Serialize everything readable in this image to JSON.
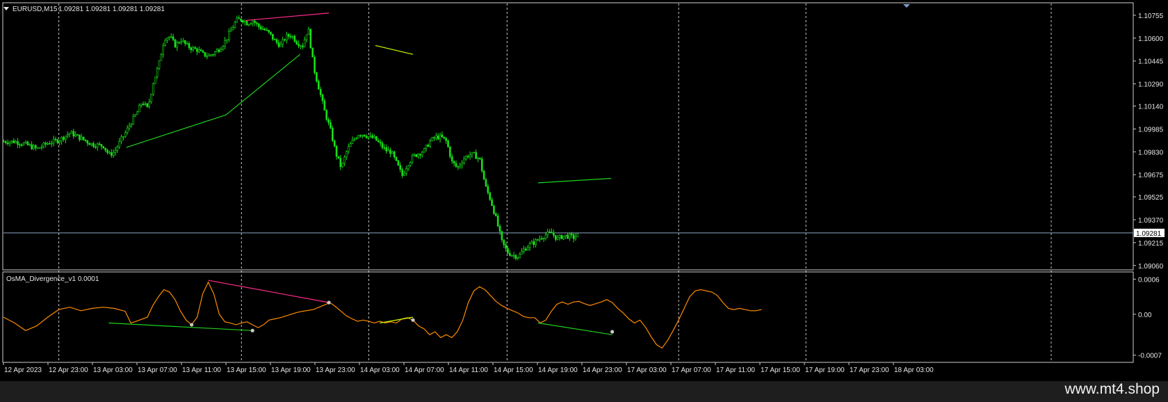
{
  "chart_data": [
    {
      "type": "candlestick",
      "symbol_label": "EURUSD,M15",
      "ohlc_readout": "1.09281 1.09281 1.09281 1.09281",
      "yticks": [
        "1.10755",
        "1.10600",
        "1.10445",
        "1.10290",
        "1.10140",
        "1.09985",
        "1.09830",
        "1.09675",
        "1.09525",
        "1.09370",
        "1.09215",
        "1.09060"
      ],
      "ylim": [
        1.0904,
        1.1083
      ],
      "current_price": 1.09281,
      "current_price_label": "1.09281",
      "xticks": [
        "12 Apr 2023",
        "12 Apr 23:00",
        "13 Apr 03:00",
        "13 Apr 07:00",
        "13 Apr 11:00",
        "13 Apr 15:00",
        "13 Apr 19:00",
        "13 Apr 23:00",
        "14 Apr 03:00",
        "14 Apr 07:00",
        "14 Apr 11:00",
        "14 Apr 15:00",
        "14 Apr 19:00",
        "14 Apr 23:00",
        "17 Apr 03:00",
        "17 Apr 07:00",
        "17 Apr 11:00",
        "17 Apr 15:00",
        "17 Apr 19:00",
        "17 Apr 23:00",
        "18 Apr 03:00"
      ],
      "price_path": [
        [
          0,
          1.099
        ],
        [
          1,
          1.099
        ],
        [
          2,
          1.0988
        ],
        [
          3,
          1.0985
        ],
        [
          4,
          1.0989
        ],
        [
          5,
          1.0991
        ],
        [
          6,
          1.0996
        ],
        [
          7,
          1.0992
        ],
        [
          8,
          1.0988
        ],
        [
          9,
          1.0987
        ],
        [
          9.5,
          1.0981
        ],
        [
          10,
          1.0983
        ],
        [
          10.5,
          1.099
        ],
        [
          11,
          1.0996
        ],
        [
          11.5,
          1.1003
        ],
        [
          12,
          1.1009
        ],
        [
          12.5,
          1.1017
        ],
        [
          13,
          1.1012
        ],
        [
          13.5,
          1.103
        ],
        [
          14,
          1.1042
        ],
        [
          14.5,
          1.106
        ],
        [
          15,
          1.1061
        ],
        [
          15.5,
          1.1055
        ],
        [
          16,
          1.1059
        ],
        [
          16.5,
          1.1055
        ],
        [
          17,
          1.1053
        ],
        [
          17.5,
          1.1052
        ],
        [
          18,
          1.1049
        ],
        [
          18.5,
          1.1048
        ],
        [
          19,
          1.105
        ],
        [
          19.5,
          1.1053
        ],
        [
          20,
          1.1058
        ],
        [
          20.5,
          1.1065
        ],
        [
          21,
          1.1072
        ],
        [
          21.5,
          1.1073
        ],
        [
          22,
          1.107
        ],
        [
          22.5,
          1.1072
        ],
        [
          23,
          1.1068
        ],
        [
          23.5,
          1.1066
        ],
        [
          24,
          1.1063
        ],
        [
          24.5,
          1.1058
        ],
        [
          25,
          1.1055
        ],
        [
          25.5,
          1.1061
        ],
        [
          26,
          1.1062
        ],
        [
          26.5,
          1.1057
        ],
        [
          27,
          1.1055
        ],
        [
          27.5,
          1.1067
        ],
        [
          28,
          1.104
        ],
        [
          28.5,
          1.1025
        ],
        [
          29,
          1.101
        ],
        [
          29.5,
          1.0998
        ],
        [
          30,
          1.0982
        ],
        [
          30.5,
          1.0972
        ],
        [
          31,
          1.0984
        ],
        [
          31.5,
          1.099
        ],
        [
          32,
          1.0995
        ],
        [
          32.5,
          1.0995
        ],
        [
          33,
          1.0993
        ],
        [
          33.5,
          1.0992
        ],
        [
          34,
          1.0988
        ],
        [
          34.5,
          1.0984
        ],
        [
          35,
          1.0983
        ],
        [
          35.5,
          1.0975
        ],
        [
          36,
          1.0967
        ],
        [
          36.5,
          1.0975
        ],
        [
          37,
          1.098
        ],
        [
          37.5,
          1.0982
        ],
        [
          38,
          1.0984
        ],
        [
          38.5,
          1.099
        ],
        [
          39,
          1.0993
        ],
        [
          39.5,
          1.0993
        ],
        [
          40,
          1.099
        ],
        [
          40.5,
          1.0976
        ],
        [
          41,
          1.0972
        ],
        [
          41.5,
          1.0978
        ],
        [
          42,
          1.0981
        ],
        [
          42.5,
          1.0981
        ],
        [
          43,
          1.0978
        ],
        [
          43.5,
          1.096
        ],
        [
          44,
          1.095
        ],
        [
          44.5,
          1.0937
        ],
        [
          45,
          1.0922
        ],
        [
          45.5,
          1.0915
        ],
        [
          46,
          1.0913
        ],
        [
          46.5,
          1.0912
        ],
        [
          47,
          1.0917
        ],
        [
          47.5,
          1.092
        ],
        [
          48,
          1.0922
        ],
        [
          48.5,
          1.0925
        ],
        [
          49,
          1.0927
        ],
        [
          49.5,
          1.0928
        ],
        [
          50,
          1.0924
        ],
        [
          50.5,
          1.0926
        ],
        [
          51,
          1.0926
        ],
        [
          51.5,
          1.0925
        ],
        [
          52,
          1.0927
        ]
      ],
      "trendlines": [
        {
          "color": "#ff2b8a",
          "from": [
            21.9,
            1.1072
          ],
          "to": [
            29.4,
            1.1077
          ]
        },
        {
          "color": "#1fd21f",
          "from": [
            11.1,
            1.0986
          ],
          "to": [
            20.1,
            1.1008
          ]
        },
        {
          "color": "#1fd21f",
          "from": [
            20.1,
            1.1008
          ],
          "to": [
            26.8,
            1.1049
          ]
        },
        {
          "color": "#c8ff00",
          "from": [
            33.6,
            1.1055
          ],
          "to": [
            37.0,
            1.1049
          ]
        },
        {
          "color": "#1fd21f",
          "from": [
            48.3,
            1.0962
          ],
          "to": [
            54.9,
            1.0965
          ]
        }
      ]
    },
    {
      "type": "line",
      "indicator_label": "OsMA_Divergence_v1 0.0001",
      "yticks": [
        "0.0006",
        "0.00",
        "-0.0007"
      ],
      "ylim": [
        -0.0008,
        0.0007
      ],
      "series": [
        {
          "color": "#ff8c00",
          "points": [
            [
              0,
              -5e-05
            ],
            [
              1,
              -0.00015
            ],
            [
              2,
              -0.00028
            ],
            [
              3,
              -0.0002
            ],
            [
              4,
              -5e-05
            ],
            [
              5,
              8e-05
            ],
            [
              6,
              0.00012
            ],
            [
              7,
              6e-05
            ],
            [
              8,
              0.0001
            ],
            [
              9,
              0.00012
            ],
            [
              10,
              0.0001
            ],
            [
              11,
              5e-05
            ],
            [
              11.5,
              -0.00015
            ],
            [
              12,
              -0.00012
            ],
            [
              13,
              -5e-05
            ],
            [
              13.5,
              0.00015
            ],
            [
              14,
              0.0003
            ],
            [
              14.5,
              0.00042
            ],
            [
              15,
              0.00038
            ],
            [
              15.5,
              0.00025
            ],
            [
              16,
              5e-05
            ],
            [
              16.5,
              -0.0001
            ],
            [
              17,
              -0.00018
            ],
            [
              17.5,
              -5e-05
            ],
            [
              18,
              0.00035
            ],
            [
              18.5,
              0.00055
            ],
            [
              19,
              0.00035
            ],
            [
              19.5,
              0.0
            ],
            [
              20,
              -0.00013
            ],
            [
              20.5,
              -0.00015
            ],
            [
              21,
              -0.00018
            ],
            [
              21.5,
              -0.00015
            ],
            [
              22,
              -0.00013
            ],
            [
              22.5,
              -0.00018
            ],
            [
              23,
              -0.00023
            ],
            [
              23.5,
              -0.00018
            ],
            [
              24,
              -0.0001
            ],
            [
              24.5,
              -8e-05
            ],
            [
              25,
              -6e-05
            ],
            [
              25.5,
              -3e-05
            ],
            [
              26,
              0.0
            ],
            [
              26.5,
              3e-05
            ],
            [
              27,
              5e-05
            ],
            [
              28,
              8e-05
            ],
            [
              29,
              0.00016
            ],
            [
              29.5,
              0.0002
            ],
            [
              30,
              0.00013
            ],
            [
              30.5,
              5e-05
            ],
            [
              31,
              -3e-05
            ],
            [
              31.5,
              -8e-05
            ],
            [
              32,
              -0.00012
            ],
            [
              32.5,
              -0.0001
            ],
            [
              33,
              -0.00012
            ],
            [
              33.5,
              -0.00015
            ],
            [
              34,
              -0.00012
            ],
            [
              34.5,
              -0.00015
            ],
            [
              35,
              -0.00013
            ],
            [
              35.5,
              -0.00015
            ],
            [
              36,
              -8e-05
            ],
            [
              36.5,
              -6e-05
            ],
            [
              37,
              -0.0001
            ],
            [
              37.5,
              -0.0002
            ],
            [
              38,
              -0.00025
            ],
            [
              38.5,
              -0.00035
            ],
            [
              39,
              -0.0003
            ],
            [
              39.5,
              -0.0004
            ],
            [
              40,
              -0.00035
            ],
            [
              40.5,
              -0.0004
            ],
            [
              41,
              -0.0003
            ],
            [
              41.5,
              -0.0001
            ],
            [
              42,
              0.0002
            ],
            [
              42.5,
              0.0004
            ],
            [
              43,
              0.00047
            ],
            [
              43.5,
              0.00042
            ],
            [
              44,
              0.00032
            ],
            [
              44.5,
              0.00022
            ],
            [
              45,
              0.00015
            ],
            [
              45.5,
              0.0001
            ],
            [
              46,
              6e-05
            ],
            [
              46.5,
              2e-05
            ],
            [
              47,
              -4e-05
            ],
            [
              47.5,
              -6e-05
            ],
            [
              48,
              -6e-05
            ],
            [
              48.5,
              -0.00015
            ],
            [
              49,
              -0.0001
            ],
            [
              49.5,
              5e-05
            ],
            [
              50,
              0.00017
            ],
            [
              50.5,
              0.00021
            ],
            [
              51,
              0.00017
            ],
            [
              51.5,
              0.00021
            ],
            [
              52,
              0.00022
            ],
            [
              52.5,
              0.00018
            ],
            [
              53,
              0.00015
            ],
            [
              53.5,
              0.00018
            ],
            [
              54,
              0.00021
            ],
            [
              54.5,
              0.00025
            ],
            [
              55,
              0.0002
            ],
            [
              55.5,
              0.0001
            ],
            [
              56,
              2e-05
            ],
            [
              56.5,
              -8e-05
            ],
            [
              57,
              -0.00015
            ],
            [
              57.5,
              -0.0001
            ],
            [
              58,
              -0.00022
            ],
            [
              58.5,
              -0.00038
            ],
            [
              59,
              -0.00052
            ],
            [
              59.5,
              -0.00058
            ],
            [
              60,
              -0.00045
            ],
            [
              60.5,
              -0.00028
            ],
            [
              61,
              -0.0001
            ],
            [
              61.5,
              0.0001
            ],
            [
              62,
              0.0003
            ],
            [
              62.5,
              0.0004
            ],
            [
              63,
              0.00042
            ],
            [
              63.5,
              0.0004
            ],
            [
              64,
              0.00038
            ],
            [
              64.5,
              0.00032
            ],
            [
              65,
              0.0002
            ],
            [
              65.5,
              0.0001
            ],
            [
              66,
              8e-05
            ],
            [
              66.5,
              0.0001
            ],
            [
              67,
              8e-05
            ],
            [
              67.5,
              6e-05
            ],
            [
              68,
              6e-05
            ],
            [
              68.5,
              8e-05
            ]
          ]
        }
      ],
      "divergence_lines": [
        {
          "color": "#ff2b8a",
          "from": [
            18.5,
            0.00058
          ],
          "to": [
            29.4,
            0.0002
          ]
        },
        {
          "color": "#1fd21f",
          "from": [
            9.5,
            -0.00015
          ],
          "to": [
            22.5,
            -0.00028
          ]
        },
        {
          "color": "#c8ff00",
          "from": [
            34.0,
            -0.00015
          ],
          "to": [
            37.0,
            -5e-05
          ]
        },
        {
          "color": "#1fd21f",
          "from": [
            48.3,
            -0.00015
          ],
          "to": [
            55.0,
            -0.00035
          ]
        }
      ],
      "markers": [
        [
          17,
          -0.00018
        ],
        [
          22.5,
          -0.00028
        ],
        [
          29.4,
          0.0002
        ],
        [
          37,
          -0.0001
        ],
        [
          55,
          -0.0003
        ]
      ]
    }
  ],
  "watermark": "www.mt4.shop",
  "colors": {
    "bull": "#18e018",
    "grid": "#c8c8c8",
    "price_line": "#8aa3c4",
    "osma": "#ff8c00"
  }
}
